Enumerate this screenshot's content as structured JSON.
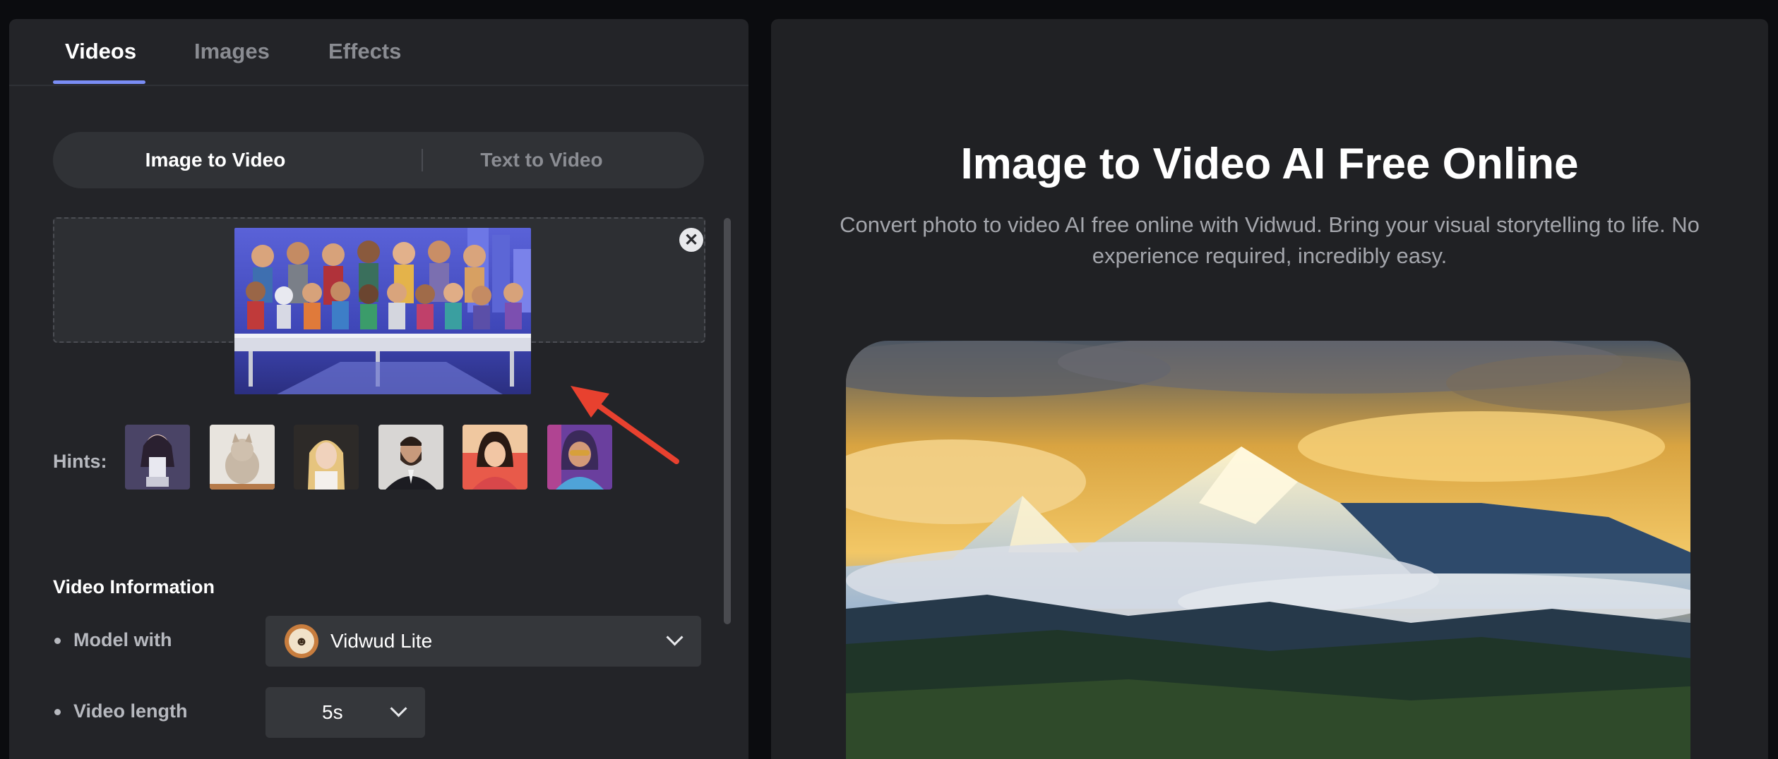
{
  "tabs": [
    {
      "label": "Videos",
      "active": true
    },
    {
      "label": "Images",
      "active": false
    },
    {
      "label": "Effects",
      "active": false
    }
  ],
  "mode_toggle": {
    "image_to_video": "Image to Video",
    "text_to_video": "Text to Video",
    "selected": "Image to Video"
  },
  "upload": {
    "close_icon": "close-icon"
  },
  "hints": {
    "label": "Hints:",
    "count": 6
  },
  "video_info": {
    "title": "Video Information",
    "model_label": "Model with",
    "model_value": "Vidwud Lite",
    "length_label": "Video length",
    "length_value": "5s"
  },
  "hero": {
    "title": "Image to Video AI Free Online",
    "description": "Convert photo to video AI free online with Vidwud. Bring your visual storytelling to life. No experience required, incredibly easy."
  },
  "colors": {
    "accent": "#7a8df5",
    "panel": "#232428",
    "arrow": "#e8412f"
  }
}
